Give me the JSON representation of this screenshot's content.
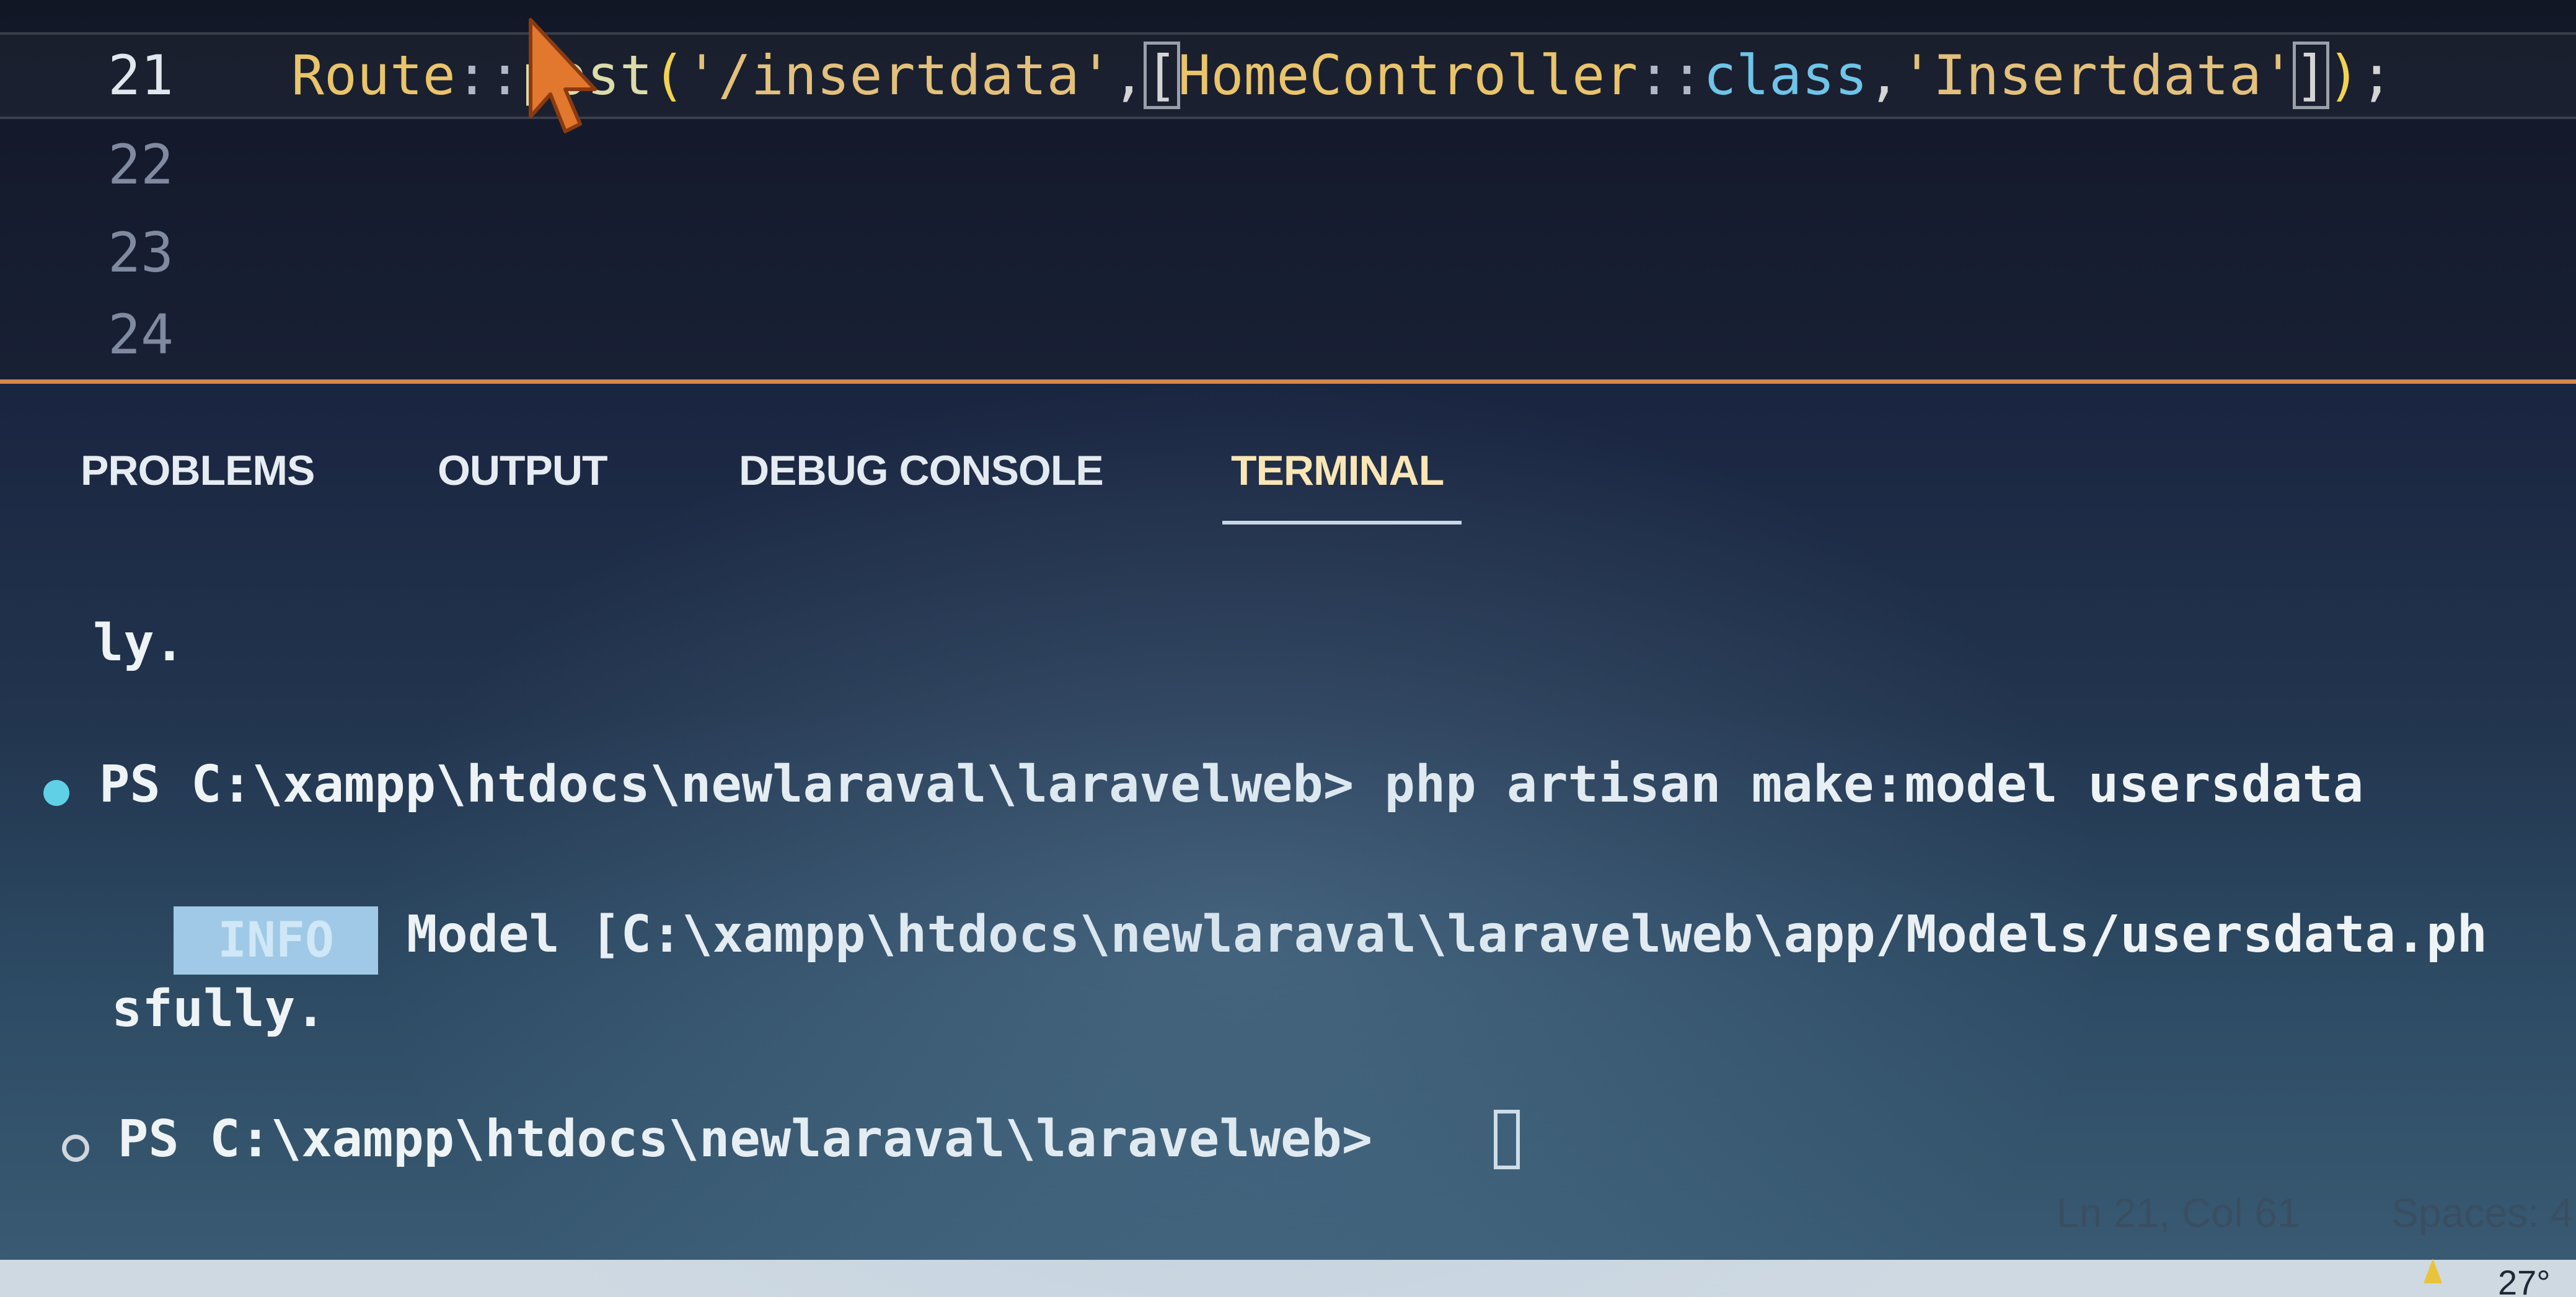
{
  "editor": {
    "lines": [
      {
        "number": "21",
        "current": true
      },
      {
        "number": "22"
      },
      {
        "number": "23"
      },
      {
        "number": "24"
      }
    ],
    "code_line_21": {
      "class_name": "Route",
      "scope_op": "::",
      "method": "post",
      "open_paren": "(",
      "path_string": "'/insertdata'",
      "comma1": ",",
      "open_bracket": "[",
      "controller": "HomeController",
      "scope_op2": "::",
      "class_kw": "class",
      "comma2": ",",
      "action_string": "'Insertdata'",
      "close_bracket": "]",
      "close_paren": ")",
      "semicolon": ";"
    }
  },
  "panel": {
    "tabs": [
      {
        "label": "PROBLEMS"
      },
      {
        "label": "OUTPUT"
      },
      {
        "label": "DEBUG CONSOLE"
      },
      {
        "label": "TERMINAL",
        "active": true
      }
    ]
  },
  "terminal": {
    "line1": "ly.",
    "prompt1": "PS C:\\xampp\\htdocs\\newlaraval\\laravelweb> php artisan make:model usersdata",
    "info_badge": "INFO",
    "info_message": "Model [C:\\xampp\\htdocs\\newlaraval\\laravelweb\\app/Models/usersdata.ph",
    "line_continuation": "sfully.",
    "prompt2": "PS C:\\xampp\\htdocs\\newlaraval\\laravelweb>"
  },
  "statusbar": {
    "position": "Ln 21, Col 61",
    "indent": "Spaces: 4"
  },
  "tray": {
    "temperature": "27°"
  },
  "colors": {
    "accent_divider": "#d8864a",
    "success_dot": "#5fd0e6",
    "info_badge": "#9fc9e6"
  },
  "icons": [
    "mouse-pointer-icon",
    "success-dot-icon",
    "idle-dot-icon",
    "weather-icon"
  ]
}
